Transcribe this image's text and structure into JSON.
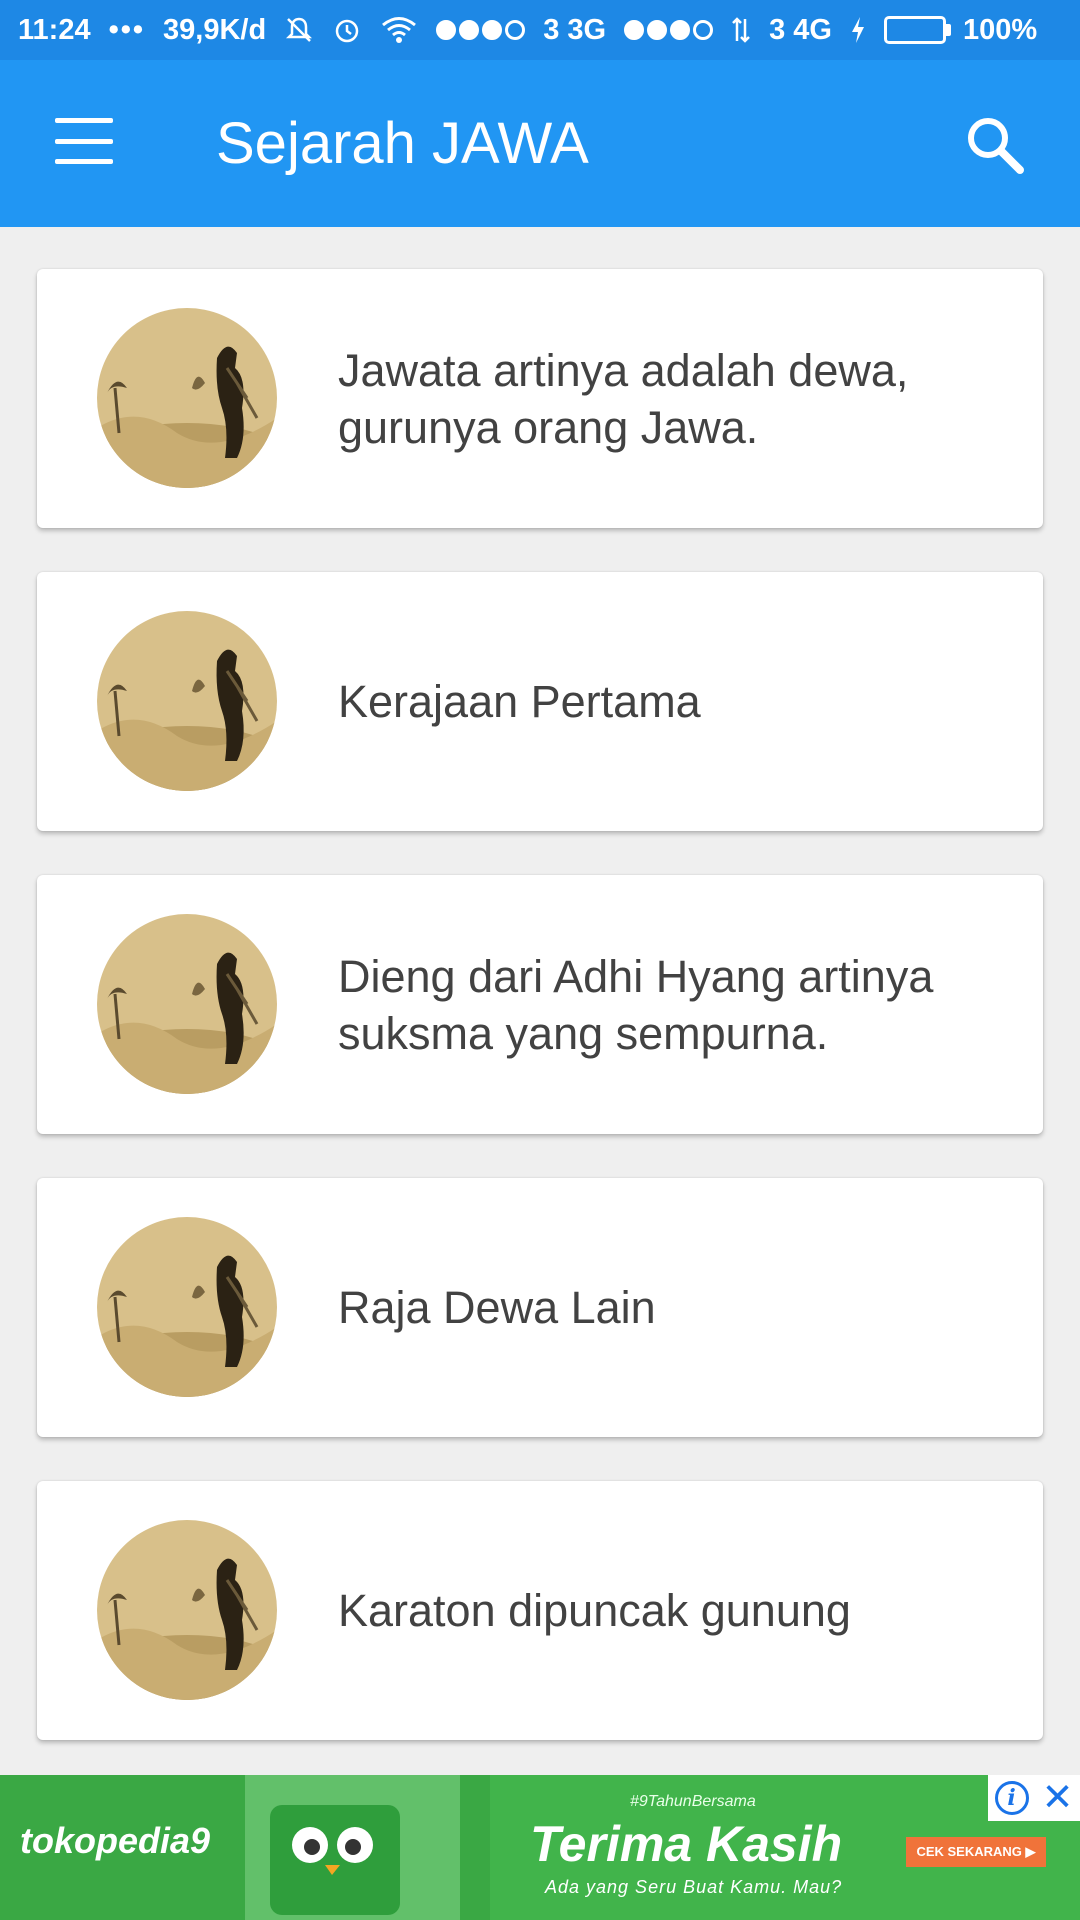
{
  "status_bar": {
    "time": "11:24",
    "more": "•••",
    "data_rate": "39,9K/d",
    "sim1_label": "3 3G",
    "sim2_label": "3 4G",
    "battery": "100%"
  },
  "app_bar": {
    "title": "Sejarah JAWA"
  },
  "items": [
    {
      "title": "Jawata artinya adalah dewa, gurunya orang Jawa."
    },
    {
      "title": "Kerajaan Pertama"
    },
    {
      "title": "Dieng dari Adhi Hyang artinya suksma yang sempurna."
    },
    {
      "title": "Raja Dewa Lain"
    },
    {
      "title": "Karaton dipuncak gunung"
    }
  ],
  "ad": {
    "brand": "tokopedia9",
    "tag": "#9TahunBersama",
    "headline": "Terima Kasih",
    "subline": "Ada yang Seru Buat Kamu. Mau?",
    "cta": "CEK SEKARANG ▶",
    "info_glyph": "i",
    "close_glyph": "✕"
  },
  "colors": {
    "app_bar": "#2196f3",
    "status_bar": "#1e88e5",
    "ad_green": "#41b44b"
  }
}
